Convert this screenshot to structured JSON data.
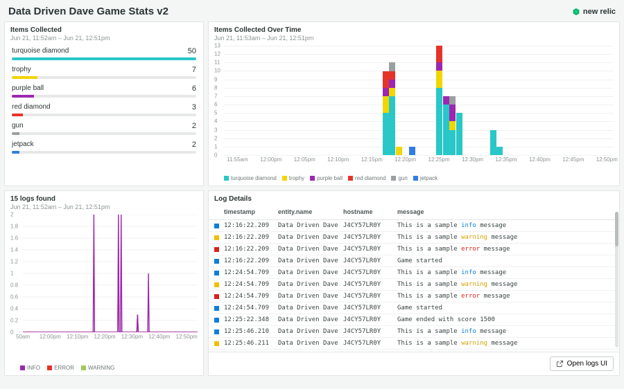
{
  "page_title": "Data Driven Dave Game Stats v2",
  "brand": "new relic",
  "colors": {
    "turquoise_diamond": "#29c7c7",
    "trophy": "#f2d600",
    "purple_ball": "#9c27b0",
    "red_diamond": "#e6332a",
    "gun": "#9a9fa1",
    "jetpack": "#2f7de1",
    "info": "#9c27b0",
    "error": "#e6332a",
    "warning": "#a3c95e",
    "log_info_dot": "#0e7ddb",
    "log_warn_dot": "#f0c000",
    "log_err_dot": "#d8211c"
  },
  "items_collected": {
    "title": "Items Collected",
    "range": "Jun 21, 11:52am – Jun 21, 12:51pm",
    "max": 50,
    "rows": [
      {
        "label": "turquoise diamond",
        "value": 50,
        "colorKey": "turquoise_diamond"
      },
      {
        "label": "trophy",
        "value": 7,
        "colorKey": "trophy"
      },
      {
        "label": "purple ball",
        "value": 6,
        "colorKey": "purple_ball"
      },
      {
        "label": "red diamond",
        "value": 3,
        "colorKey": "red_diamond"
      },
      {
        "label": "gun",
        "value": 2,
        "colorKey": "gun"
      },
      {
        "label": "jetpack",
        "value": 2,
        "colorKey": "jetpack"
      }
    ]
  },
  "chart_data": {
    "type": "bar",
    "title": "Items Collected Over Time",
    "range": "Jun 21, 11:53am – Jun 21, 12:51pm",
    "ylim": [
      0,
      13
    ],
    "yticks": [
      0,
      1,
      2,
      3,
      4,
      5,
      6,
      7,
      8,
      9,
      10,
      11,
      12,
      13
    ],
    "x_domain_min": "11:53",
    "x_domain_max": "12:51",
    "xticks": [
      "11:55am",
      "12:00pm",
      "12:05pm",
      "12:10pm",
      "12:15pm",
      "12:20pm",
      "12:25pm",
      "12:30pm",
      "12:35pm",
      "12:40pm",
      "12:45pm",
      "12:50pm"
    ],
    "legend": [
      "turquoise diamond",
      "trophy",
      "purple ball",
      "red diamond",
      "gun",
      "jetpack"
    ],
    "legend_colors": [
      "turquoise_diamond",
      "trophy",
      "purple_ball",
      "red_diamond",
      "gun",
      "jetpack"
    ],
    "bars": [
      {
        "x": "12:17",
        "stack": [
          {
            "k": "turquoise_diamond",
            "v": 5
          },
          {
            "k": "trophy",
            "v": 2
          },
          {
            "k": "purple_ball",
            "v": 1
          },
          {
            "k": "red_diamond",
            "v": 2
          }
        ]
      },
      {
        "x": "12:18",
        "stack": [
          {
            "k": "turquoise_diamond",
            "v": 7
          },
          {
            "k": "trophy",
            "v": 1
          },
          {
            "k": "purple_ball",
            "v": 1
          },
          {
            "k": "red_diamond",
            "v": 1
          },
          {
            "k": "gun",
            "v": 1
          }
        ]
      },
      {
        "x": "12:19",
        "stack": [
          {
            "k": "trophy",
            "v": 1
          }
        ]
      },
      {
        "x": "12:21",
        "stack": [
          {
            "k": "jetpack",
            "v": 1
          }
        ]
      },
      {
        "x": "12:25",
        "stack": [
          {
            "k": "turquoise_diamond",
            "v": 8
          },
          {
            "k": "trophy",
            "v": 2
          },
          {
            "k": "purple_ball",
            "v": 1
          },
          {
            "k": "red_diamond",
            "v": 2
          }
        ]
      },
      {
        "x": "12:26",
        "stack": [
          {
            "k": "turquoise_diamond",
            "v": 6
          },
          {
            "k": "purple_ball",
            "v": 1
          }
        ]
      },
      {
        "x": "12:27",
        "stack": [
          {
            "k": "turquoise_diamond",
            "v": 3
          },
          {
            "k": "trophy",
            "v": 1
          },
          {
            "k": "purple_ball",
            "v": 2
          },
          {
            "k": "gun",
            "v": 1
          }
        ]
      },
      {
        "x": "12:28",
        "stack": [
          {
            "k": "turquoise_diamond",
            "v": 5
          }
        ]
      },
      {
        "x": "12:33",
        "stack": [
          {
            "k": "turquoise_diamond",
            "v": 3
          }
        ]
      },
      {
        "x": "12:34",
        "stack": [
          {
            "k": "turquoise_diamond",
            "v": 1
          }
        ]
      }
    ]
  },
  "logs_chart": {
    "title": "15 logs found",
    "range": "Jun 21, 11:52am – Jun 21, 12:51pm",
    "ylim": [
      0,
      2
    ],
    "yticks": [
      0,
      0.2,
      0.4,
      0.6,
      0.8,
      1,
      1.2,
      1.4,
      1.6,
      1.8,
      2
    ],
    "x_domain_min": "11:50",
    "x_domain_max": "12:54",
    "xticks": [
      "50am",
      "12:00pm",
      "12:10pm",
      "12:20pm",
      "12:30pm",
      "12:40pm",
      "12:50pm"
    ],
    "legend": [
      "INFO",
      "ERROR",
      "WARNING"
    ],
    "spikes": [
      {
        "x": "12:16",
        "INFO": 2,
        "ERROR": 0,
        "WARNING": 0
      },
      {
        "x": "12:25",
        "INFO": 2,
        "ERROR": 1.3,
        "WARNING": 1.3
      },
      {
        "x": "12:26",
        "INFO": 2,
        "ERROR": 0,
        "WARNING": 0
      },
      {
        "x": "12:32",
        "INFO": 0.3,
        "ERROR": 0.3,
        "WARNING": 0.3
      },
      {
        "x": "12:36",
        "INFO": 1,
        "ERROR": 0,
        "WARNING": 0
      }
    ]
  },
  "log_table": {
    "title": "Log Details",
    "open_button": "Open logs UI",
    "columns": [
      "timestamp",
      "entity.name",
      "hostname",
      "message"
    ],
    "rows": [
      {
        "level": "info",
        "timestamp": "12:16:22.209",
        "entity": "Data Driven Dave",
        "host": "J4CY57LR0Y",
        "message": "This is a sample info message"
      },
      {
        "level": "warning",
        "timestamp": "12:16:22.209",
        "entity": "Data Driven Dave",
        "host": "J4CY57LR0Y",
        "message": "This is a sample warning message"
      },
      {
        "level": "error",
        "timestamp": "12:16:22.209",
        "entity": "Data Driven Dave",
        "host": "J4CY57LR0Y",
        "message": "This is a sample error message"
      },
      {
        "level": "info",
        "timestamp": "12:16:22.209",
        "entity": "Data Driven Dave",
        "host": "J4CY57LR0Y",
        "message": "Game started"
      },
      {
        "level": "info",
        "timestamp": "12:24:54.709",
        "entity": "Data Driven Dave",
        "host": "J4CY57LR0Y",
        "message": "This is a sample info message"
      },
      {
        "level": "warning",
        "timestamp": "12:24:54.709",
        "entity": "Data Driven Dave",
        "host": "J4CY57LR0Y",
        "message": "This is a sample warning message"
      },
      {
        "level": "error",
        "timestamp": "12:24:54.709",
        "entity": "Data Driven Dave",
        "host": "J4CY57LR0Y",
        "message": "This is a sample error message"
      },
      {
        "level": "info",
        "timestamp": "12:24:54.709",
        "entity": "Data Driven Dave",
        "host": "J4CY57LR0Y",
        "message": "Game started"
      },
      {
        "level": "info",
        "timestamp": "12:25:22.348",
        "entity": "Data Driven Dave",
        "host": "J4CY57LR0Y",
        "message": "Game ended with score 1500"
      },
      {
        "level": "info",
        "timestamp": "12:25:46.210",
        "entity": "Data Driven Dave",
        "host": "J4CY57LR0Y",
        "message": "This is a sample info message"
      },
      {
        "level": "warning",
        "timestamp": "12:25:46.211",
        "entity": "Data Driven Dave",
        "host": "J4CY57LR0Y",
        "message": "This is a sample warning message"
      }
    ]
  }
}
